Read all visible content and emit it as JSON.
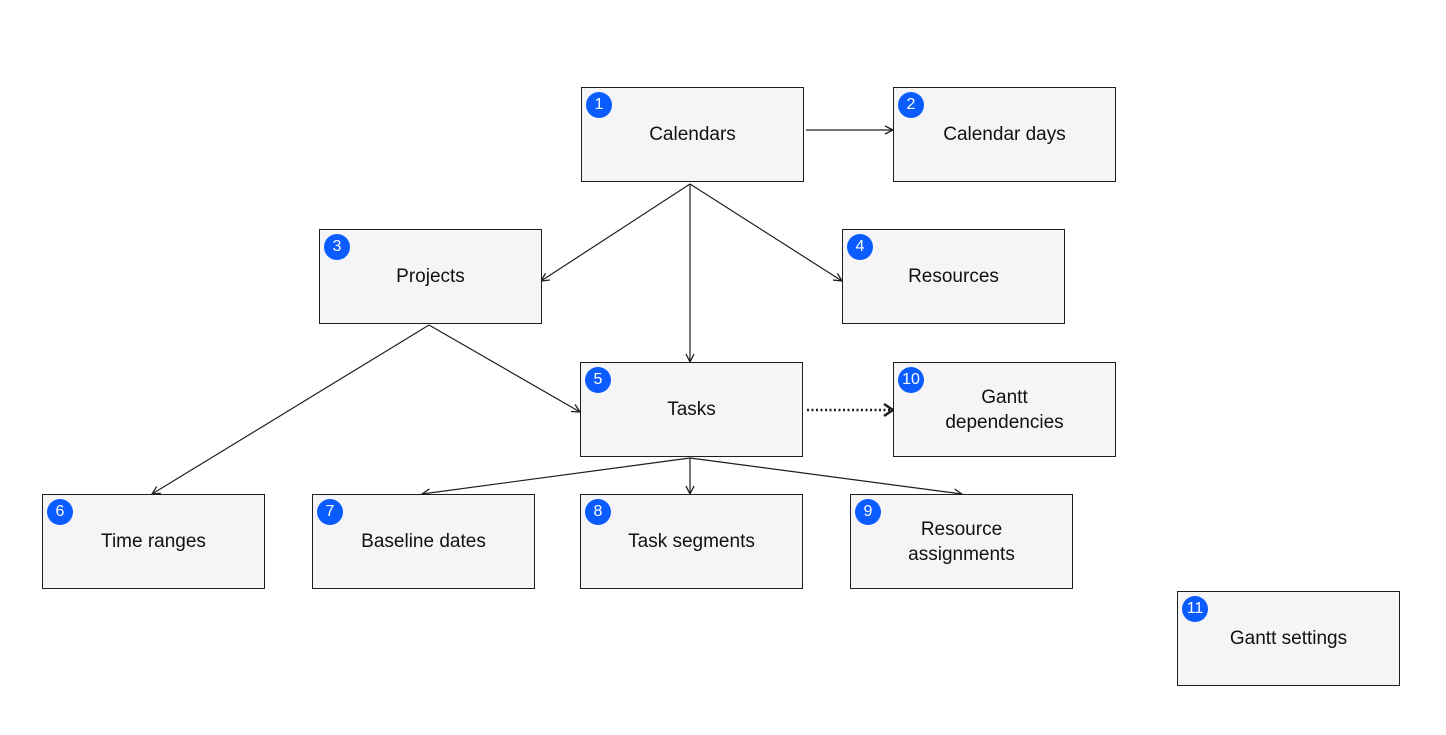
{
  "colors": {
    "badge": "#0a5cff",
    "node_fill": "#f5f5f7",
    "stroke": "#1e1e1e"
  },
  "nodes": [
    {
      "id": "calendars",
      "badge": "1",
      "label": "Calendars"
    },
    {
      "id": "calendar-days",
      "badge": "2",
      "label": "Calendar days"
    },
    {
      "id": "projects",
      "badge": "3",
      "label": "Projects"
    },
    {
      "id": "resources",
      "badge": "4",
      "label": "Resources"
    },
    {
      "id": "tasks",
      "badge": "5",
      "label": "Tasks"
    },
    {
      "id": "time-ranges",
      "badge": "6",
      "label": "Time ranges"
    },
    {
      "id": "baseline-dates",
      "badge": "7",
      "label": "Baseline dates"
    },
    {
      "id": "task-segments",
      "badge": "8",
      "label": "Task segments"
    },
    {
      "id": "resource-assignments",
      "badge": "9",
      "label": "Resource\nassignments"
    },
    {
      "id": "gantt-dependencies",
      "badge": "10",
      "label": "Gantt\ndependencies"
    },
    {
      "id": "gantt-settings",
      "badge": "11",
      "label": "Gantt settings"
    }
  ],
  "edges": [
    {
      "from": "calendars",
      "to": "calendar-days",
      "style": "solid"
    },
    {
      "from": "calendars",
      "to": "projects",
      "style": "solid"
    },
    {
      "from": "calendars",
      "to": "tasks",
      "style": "solid"
    },
    {
      "from": "calendars",
      "to": "resources",
      "style": "solid"
    },
    {
      "from": "projects",
      "to": "time-ranges",
      "style": "solid"
    },
    {
      "from": "projects",
      "to": "tasks",
      "style": "solid"
    },
    {
      "from": "tasks",
      "to": "gantt-dependencies",
      "style": "dotted"
    },
    {
      "from": "tasks",
      "to": "baseline-dates",
      "style": "solid"
    },
    {
      "from": "tasks",
      "to": "task-segments",
      "style": "solid"
    },
    {
      "from": "tasks",
      "to": "resource-assignments",
      "style": "solid"
    }
  ]
}
